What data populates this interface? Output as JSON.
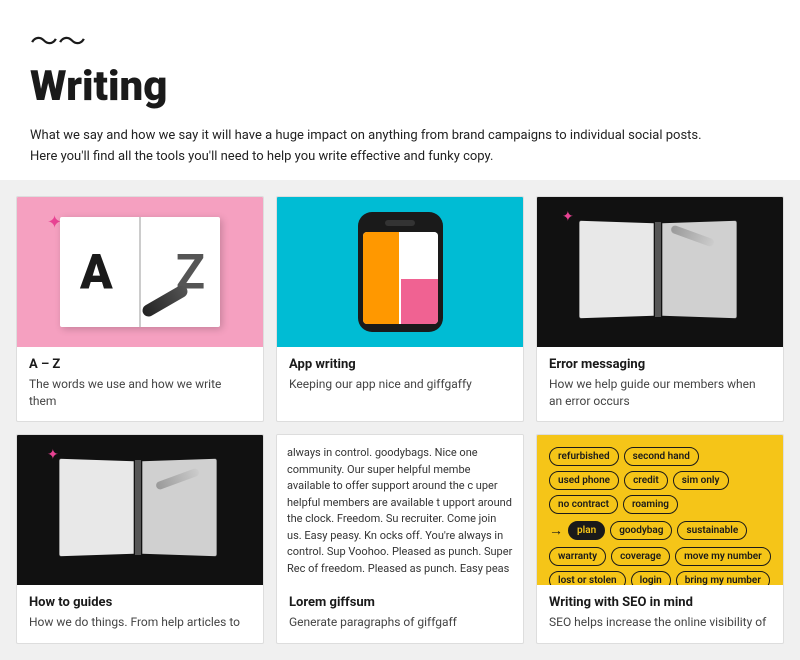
{
  "header": {
    "icon": "〜",
    "title": "Writing",
    "description": "What we say and how we say it will have a huge impact on anything from brand campaigns to individual social posts. Here you'll find all the tools you'll need to help you write effective and funky copy."
  },
  "cards": [
    {
      "id": "az",
      "title": "A – Z",
      "description": "The words we use and how we write them",
      "type": "az"
    },
    {
      "id": "app-writing",
      "title": "App writing",
      "description": "Keeping our app nice and giffgaffy",
      "type": "app"
    },
    {
      "id": "error-messaging",
      "title": "Error messaging",
      "description": "How we help guide our members when an error occurs",
      "type": "error"
    },
    {
      "id": "how-to-guides",
      "title": "How to guides",
      "description": "How we do things. From help articles to",
      "type": "guides"
    },
    {
      "id": "lorem-giffsum",
      "title": "Lorem giffsum",
      "description": "Generate paragraphs of giffgaff",
      "type": "lorem",
      "body_text": "always in control. goodybags. Nice one community. Our super helpful membe available to offer support around the c uper helpful members are available t upport around the clock. Freedom. Su recruiter. Come join us. Easy peasy. Kn ocks off. You're always in control. Sup Voohoo. Pleased as punch. Super Rec of freedom. Pleased as punch. Easy peas"
    },
    {
      "id": "writing-seo",
      "title": "Writing with SEO in mind",
      "description": "SEO helps increase the online visibility of",
      "type": "seo",
      "tags": [
        {
          "label": "refurbished",
          "highlighted": false
        },
        {
          "label": "second hand",
          "highlighted": false
        },
        {
          "label": "used phone",
          "highlighted": false
        },
        {
          "label": "credit",
          "highlighted": false
        },
        {
          "label": "sim only",
          "highlighted": false
        },
        {
          "label": "no contract",
          "highlighted": false
        },
        {
          "label": "roaming",
          "highlighted": false
        },
        {
          "label": "plan",
          "highlighted": true
        },
        {
          "label": "goodybag",
          "highlighted": false
        },
        {
          "label": "sustainable",
          "highlighted": false
        },
        {
          "label": "warranty",
          "highlighted": false
        },
        {
          "label": "coverage",
          "highlighted": false
        },
        {
          "label": "move my number",
          "highlighted": false
        },
        {
          "label": "lost or stolen",
          "highlighted": false
        },
        {
          "label": "login",
          "highlighted": false
        },
        {
          "label": "bring my number",
          "highlighted": false
        }
      ]
    }
  ]
}
